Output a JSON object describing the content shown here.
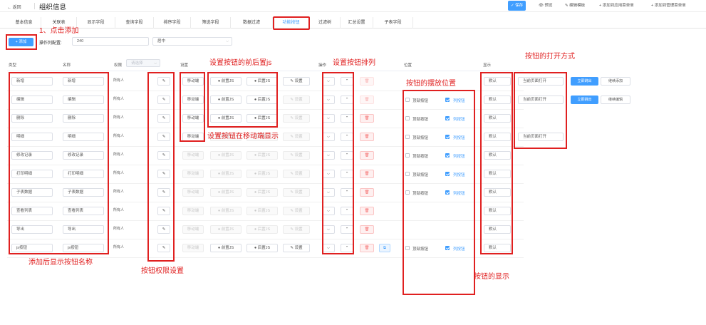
{
  "header": {
    "back": "← 返回",
    "title": "组织信息",
    "actions": [
      "✓ 保存",
      "👁 预览",
      "✎ 编辑模板",
      "+ 添加到应用菜单单",
      "+ 添加到管理菜单单"
    ]
  },
  "tabs": [
    "基本信息",
    "关联表",
    "显示字段",
    "查询字段",
    "排序字段",
    "筛选字段",
    "数据过滤",
    "功能按钮",
    "过滤树",
    "汇总设置",
    "子表字段"
  ],
  "active_tab": "功能按钮",
  "toolbar": {
    "add_label": "+ 添加",
    "op_col_label": "操作列配置:",
    "width_value": "240",
    "align_value": "居中"
  },
  "columns": {
    "type": "类型",
    "name": "名称",
    "permission": "权限",
    "permission_placeholder": "请选择",
    "settings": "设置",
    "operation": "操作",
    "position": "位置",
    "display": "显示"
  },
  "rows": [
    {
      "type": "新增",
      "name": "新增",
      "perm": "所有人",
      "mobile": true,
      "js_active": true,
      "setting_active": true,
      "position": false,
      "display": "默认",
      "open": "当前页面打开",
      "extra": [
        "立即跳出",
        "继续添加"
      ],
      "extra_icon": false
    },
    {
      "type": "编辑",
      "name": "编辑",
      "perm": "所有人",
      "mobile": true,
      "js_active": true,
      "setting_active": false,
      "position": true,
      "display": "默认",
      "open": "当前页面打开",
      "extra": [
        "立即跳出",
        "继续编辑"
      ],
      "extra_icon": false
    },
    {
      "type": "删除",
      "name": "删除",
      "perm": "所有人",
      "mobile": true,
      "js_active": true,
      "setting_active": false,
      "position": true,
      "display": "默认",
      "open": "",
      "extra": [],
      "extra_icon": false
    },
    {
      "type": "明细",
      "name": "明细",
      "perm": "所有人",
      "mobile": true,
      "js_active": false,
      "setting_active": false,
      "position": true,
      "display": "默认",
      "open": "当前页面打开",
      "extra": [],
      "extra_icon": false
    },
    {
      "type": "修改记录",
      "name": "修改记录",
      "perm": "所有人",
      "mobile": false,
      "js_active": false,
      "setting_active": false,
      "position": true,
      "display": "默认",
      "open": "",
      "extra": [],
      "extra_icon": false
    },
    {
      "type": "打印明细",
      "name": "打印明细",
      "perm": "所有人",
      "mobile": false,
      "js_active": false,
      "setting_active": false,
      "position": true,
      "display": "默认",
      "open": "",
      "extra": [],
      "extra_icon": false
    },
    {
      "type": "子表数据",
      "name": "子表数据",
      "perm": "所有人",
      "mobile": false,
      "js_active": false,
      "setting_active": false,
      "position": true,
      "display": "默认",
      "open": "",
      "extra": [],
      "extra_icon": false
    },
    {
      "type": "查看列表",
      "name": "查看列表",
      "perm": "所有人",
      "mobile": false,
      "js_active": false,
      "setting_active": false,
      "position": false,
      "display": "默认",
      "open": "",
      "extra": [],
      "extra_icon": false
    },
    {
      "type": "导出",
      "name": "导出",
      "perm": "所有人",
      "mobile": false,
      "js_active": false,
      "setting_active": false,
      "position": false,
      "display": "默认",
      "open": "",
      "extra": [],
      "extra_icon": false
    },
    {
      "type": "js按钮",
      "name": "js按钮",
      "perm": "所有人",
      "mobile": false,
      "js_active": true,
      "setting_active": true,
      "position": true,
      "display": "默认",
      "open": "",
      "extra": [],
      "extra_icon": true
    }
  ],
  "labels": {
    "mobile": "移动端",
    "pre_js": "前置JS",
    "post_js": "后置JS",
    "setting": "设置",
    "top_btn": "顶部按钮",
    "col_btn": "列按钮"
  },
  "icons": {
    "edit": "edit-icon",
    "up": "arrow-up-icon",
    "down": "arrow-down-icon",
    "delete": "trash-icon",
    "chevron": "chevron-down-icon"
  },
  "annotations": {
    "click_add": "1、点击添加",
    "prepost_js": "设置按钮的前后置js",
    "sort": "设置按钮排列",
    "open_mode": "按钮的打开方式",
    "position": "按钮的摆放位置",
    "mobile": "设置按钮在移动端显示",
    "names": "添加后显示按钮名称",
    "perm": "按钮权限设置",
    "display": "按钮的显示"
  },
  "colors": {
    "primary": "#409eff",
    "annotation": "#e02020",
    "danger": "#f56c6c"
  }
}
